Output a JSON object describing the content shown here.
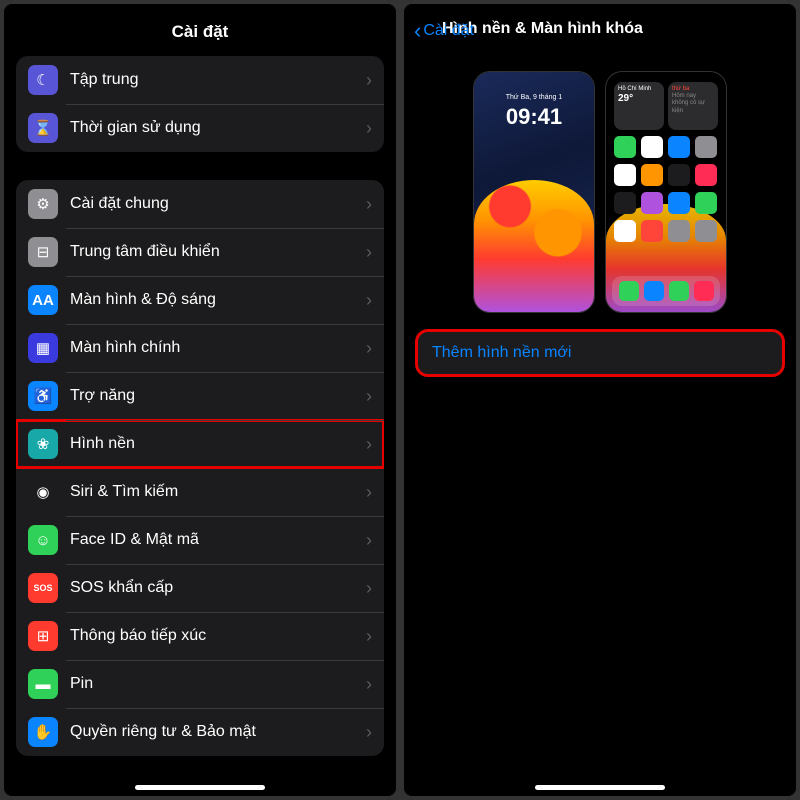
{
  "left": {
    "title": "Cài đặt",
    "group1": [
      {
        "label": "Tập trung",
        "iconColor": "#5856d6",
        "glyph": "☾"
      },
      {
        "label": "Thời gian sử dụng",
        "iconColor": "#5856d6",
        "glyph": "⌛"
      }
    ],
    "group2": [
      {
        "label": "Cài đặt chung",
        "iconColor": "#8e8e93",
        "glyph": "⚙"
      },
      {
        "label": "Trung tâm điều khiển",
        "iconColor": "#8e8e93",
        "glyph": "⊟"
      },
      {
        "label": "Màn hình & Độ sáng",
        "iconColor": "#0a84ff",
        "glyph": "AA"
      },
      {
        "label": "Màn hình chính",
        "iconColor": "#3a3adf",
        "glyph": "▦"
      },
      {
        "label": "Trợ năng",
        "iconColor": "#0a84ff",
        "glyph": "♿"
      },
      {
        "label": "Hình nền",
        "iconColor": "#18a8a8",
        "glyph": "❀",
        "highlight": true
      },
      {
        "label": "Siri & Tìm kiếm",
        "iconColor": "#1c1c1e",
        "glyph": "◉"
      },
      {
        "label": "Face ID & Mật mã",
        "iconColor": "#30d158",
        "glyph": "☺"
      },
      {
        "label": "SOS khẩn cấp",
        "iconColor": "#ff3b30",
        "glyph": "SOS"
      },
      {
        "label": "Thông báo tiếp xúc",
        "iconColor": "#ff3b30",
        "glyph": "⊞"
      },
      {
        "label": "Pin",
        "iconColor": "#30d158",
        "glyph": "▬"
      },
      {
        "label": "Quyền riêng tư & Bảo mật",
        "iconColor": "#0a84ff",
        "glyph": "✋"
      }
    ]
  },
  "right": {
    "backLabel": "Cài đặt",
    "title": "Hình nền & Màn hình khóa",
    "lockPreview": {
      "date": "Thứ Ba, 9 tháng 1",
      "time": "09:41"
    },
    "homePreview": {
      "widgetCity": "Hồ Chí Minh",
      "widgetTemp": "29°",
      "widgetDay": "thứ ba",
      "widgetNote": "Hôm nay không có sự kiện"
    },
    "addButton": "Thêm hình nền mới"
  }
}
